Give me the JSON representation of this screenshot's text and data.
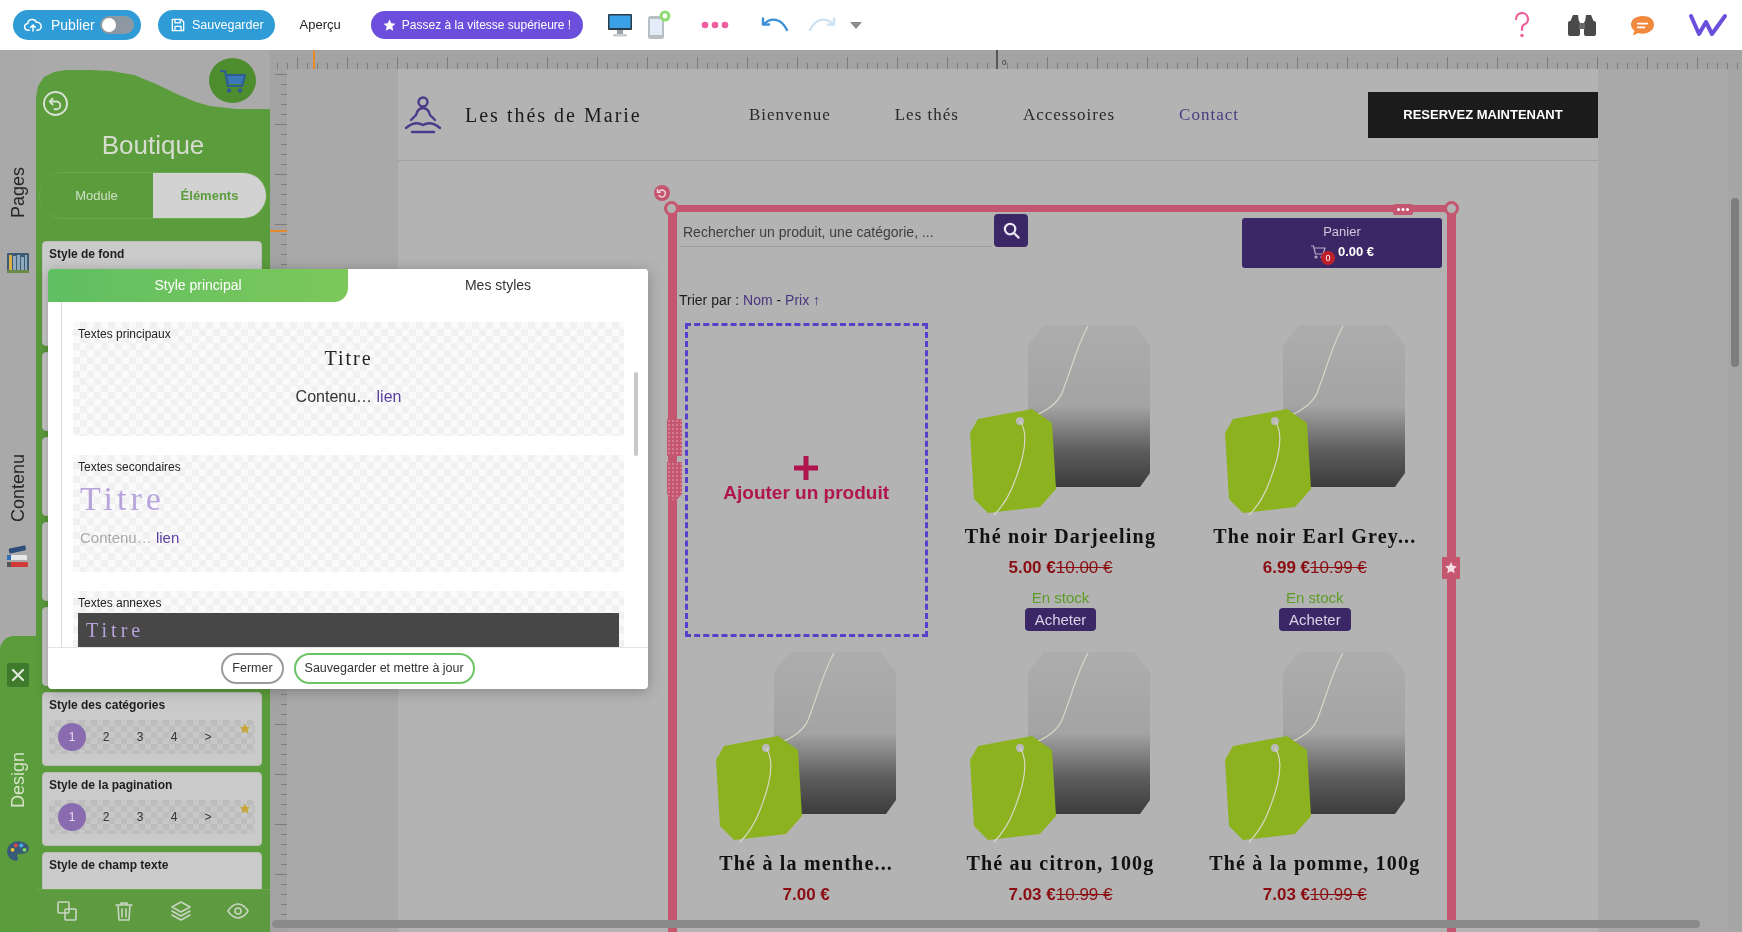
{
  "toolbar": {
    "publish": {
      "label": "Publier",
      "on": false
    },
    "save": {
      "label": "Sauvegarder"
    },
    "preview": {
      "label": "Aperçu"
    },
    "upgrade": {
      "label": "Passez à la vitesse supérieure !"
    },
    "devices": [
      {
        "kind": "desktop",
        "selected": true
      },
      {
        "kind": "mobile",
        "selected": false
      }
    ],
    "undo": {
      "disabled": false
    },
    "redo": {
      "disabled": true
    }
  },
  "side_tabs": [
    {
      "label": "Pages",
      "selected": false
    },
    {
      "label": "Contenu",
      "selected": false
    },
    {
      "label": "Design",
      "selected": true
    }
  ],
  "panel": {
    "title": "Boutique",
    "tabs": [
      {
        "label": "Module",
        "selected": false
      },
      {
        "label": "Éléments",
        "selected": true
      }
    ],
    "cards": [
      {
        "kind": "plain",
        "title": "Style de fond"
      },
      {
        "kind": "pager",
        "title": "Style des catégories",
        "pages": [
          {
            "label": "1",
            "selected": true
          },
          {
            "label": "2",
            "selected": false
          },
          {
            "label": "3",
            "selected": false
          },
          {
            "label": "4",
            "selected": false
          },
          {
            "label": ">",
            "selected": false
          }
        ]
      },
      {
        "kind": "pager",
        "title": "Style de la pagination",
        "pages": [
          {
            "label": "1",
            "selected": true
          },
          {
            "label": "2",
            "selected": false
          },
          {
            "label": "3",
            "selected": false
          },
          {
            "label": "4",
            "selected": false
          },
          {
            "label": ">",
            "selected": false
          }
        ]
      },
      {
        "kind": "plain",
        "title": "Style de champ texte"
      }
    ]
  },
  "ruler": {
    "origin": "0"
  },
  "site": {
    "brand": "Les thés de Marie",
    "nav": [
      {
        "label": "Bienvenue",
        "selected": false
      },
      {
        "label": "Les thés",
        "selected": false
      },
      {
        "label": "Accessoires",
        "selected": false
      },
      {
        "label": "Contact",
        "selected": true
      }
    ],
    "cta": "RESERVEZ MAINTENANT"
  },
  "shop": {
    "search": {
      "placeholder": "Rechercher un produit, une catégorie, ..."
    },
    "cart": {
      "label": "Panier",
      "count": "0",
      "total": "0.00 €"
    },
    "sort": {
      "label": "Trier par :",
      "options": [
        "Nom",
        "Prix"
      ],
      "separator": "-",
      "direction": "↑"
    },
    "add_product": {
      "label": "Ajouter un produit"
    },
    "products": [
      {
        "name": "Thé noir Darjeeling",
        "price": "5.00 €",
        "old_price": "10.00 €",
        "stock": "En stock",
        "action": "Acheter"
      },
      {
        "name": "The noir Earl Grey...",
        "price": "6.99 €",
        "old_price": "10.99 €",
        "stock": "En stock",
        "action": "Acheter"
      },
      {
        "name": "Thé à la menthe...",
        "price": "7.00 €"
      },
      {
        "name": "Thé au citron, 100g",
        "price": "7.03 €",
        "old_price": "10.99 €"
      },
      {
        "name": "Thé à la pomme, 100g",
        "price": "7.03 €",
        "old_price": "10.99 €"
      }
    ]
  },
  "modal": {
    "tabs": [
      {
        "label": "Style principal",
        "selected": true
      },
      {
        "label": "Mes styles",
        "selected": false
      }
    ],
    "sections": [
      {
        "kind": "main",
        "label": "Textes principaux",
        "title": "Titre",
        "content": "Contenu…",
        "link": "lien"
      },
      {
        "kind": "secondary",
        "label": "Textes secondaires",
        "title": "Titre",
        "content": "Contenu…",
        "link": "lien"
      },
      {
        "kind": "annex",
        "label": "Textes annexes",
        "title": "Titre"
      }
    ],
    "buttons": [
      {
        "kind": "outline",
        "label": "Fermer"
      },
      {
        "kind": "primary",
        "label": "Sauvegarder et mettre à jour"
      }
    ]
  }
}
